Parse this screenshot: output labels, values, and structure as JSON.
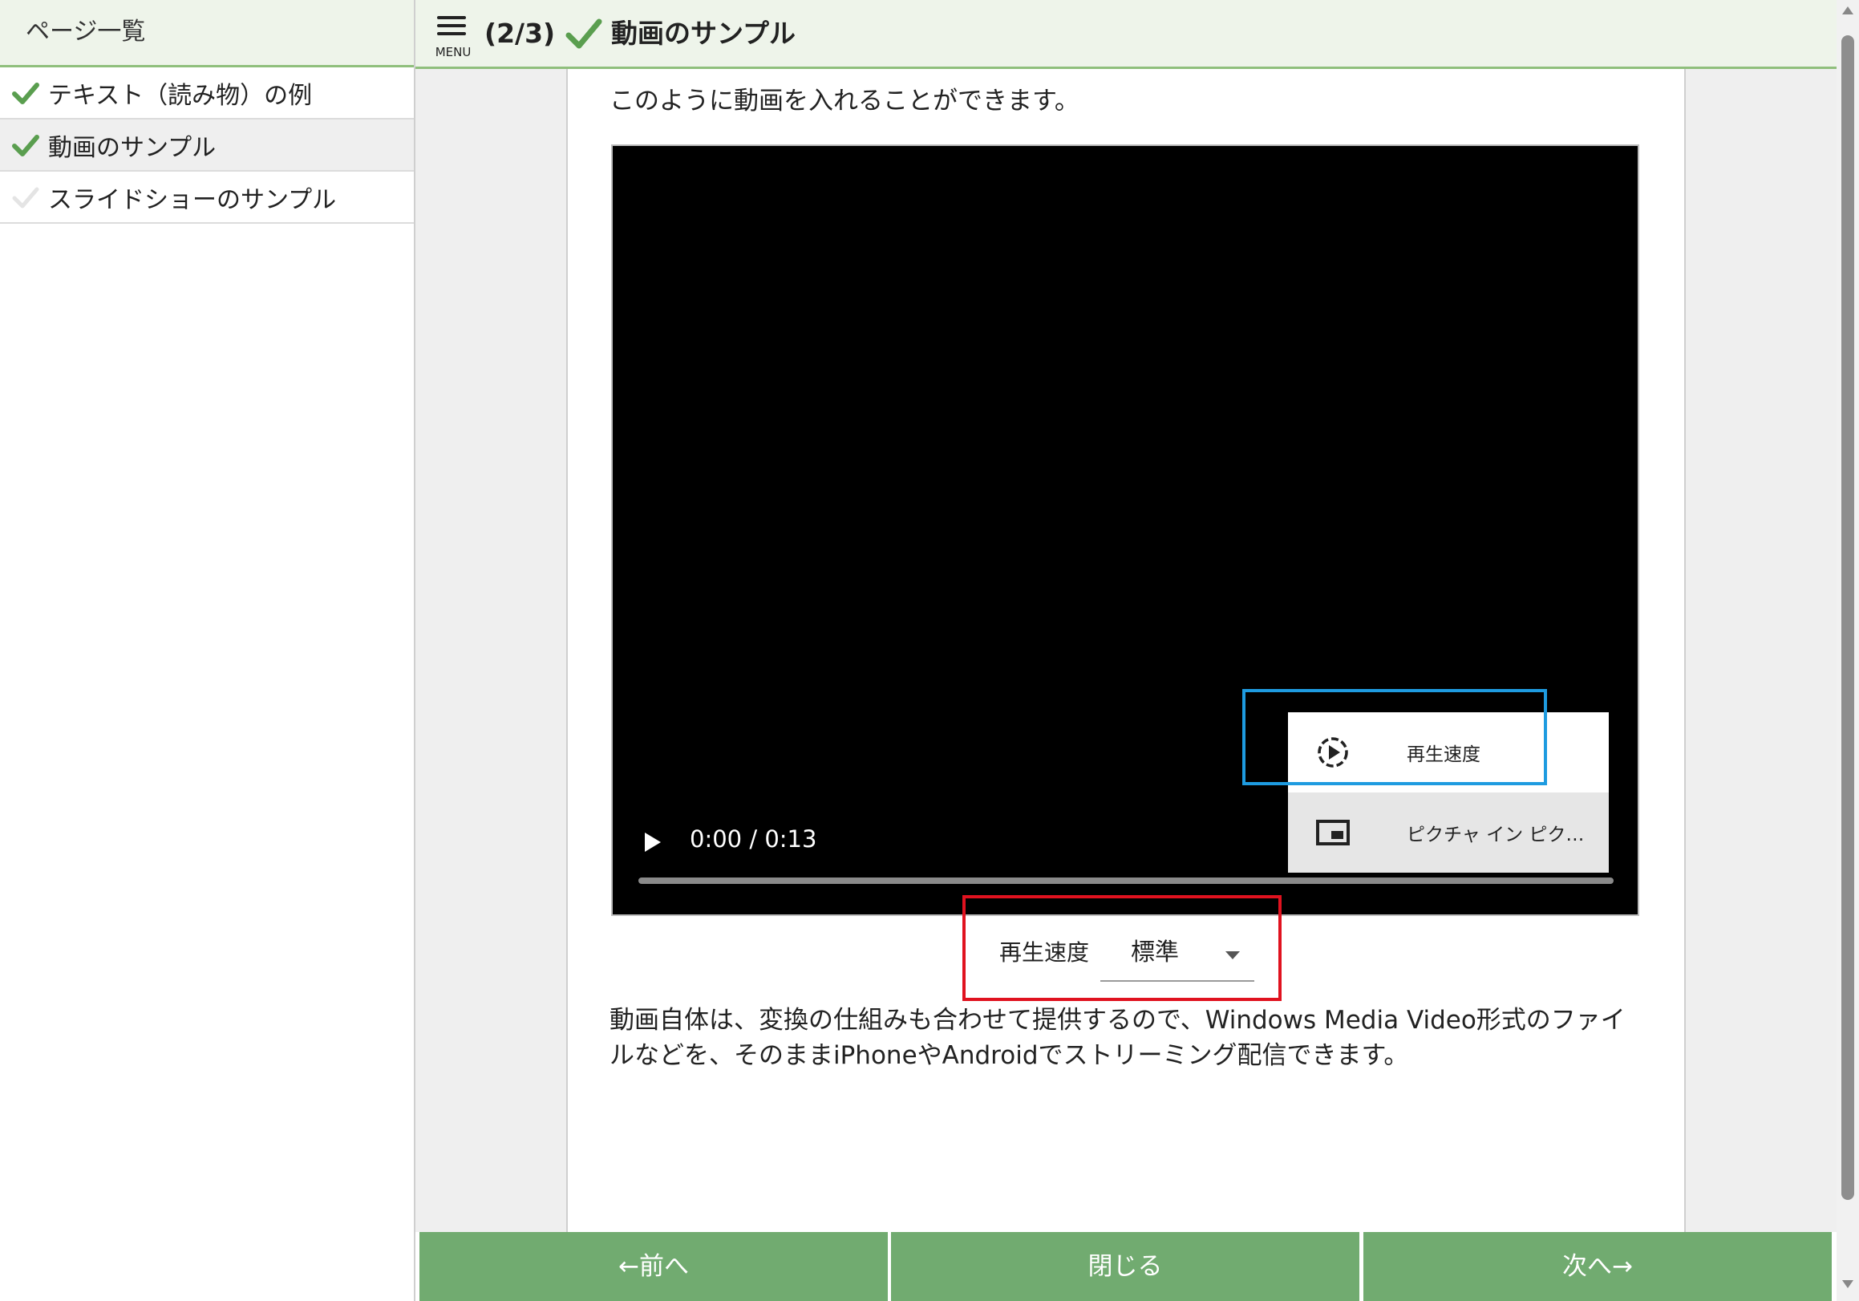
{
  "sidebar": {
    "header": "ページ一覧",
    "items": [
      {
        "label": "テキスト（読み物）の例",
        "done": true
      },
      {
        "label": "動画のサンプル",
        "done": true,
        "active": true
      },
      {
        "label": "スライドショーのサンプル",
        "done": false
      }
    ]
  },
  "topbar": {
    "menu_label": "MENU",
    "page_count": "(2/3)",
    "title": "動画のサンプル"
  },
  "content": {
    "intro": "このように動画を入れることができます。",
    "video": {
      "time": "0:00 / 0:13",
      "menu": [
        "再生速度",
        "ピクチャ イン ピク…"
      ]
    },
    "speed": {
      "label": "再生速度",
      "value": "標準"
    },
    "description": "動画自体は、変換の仕組みも合わせて提供するので、Windows Media Video形式のファイルなどを、そのままiPhoneやAndroidでストリーミング配信できます。"
  },
  "nav": {
    "prev": "←前へ",
    "close": "閉じる",
    "next": "次へ→"
  },
  "colors": {
    "accent_green": "#71ab70",
    "check_green": "#5a9e4f",
    "highlight_blue": "#1e9be0",
    "highlight_red": "#e0121f"
  }
}
